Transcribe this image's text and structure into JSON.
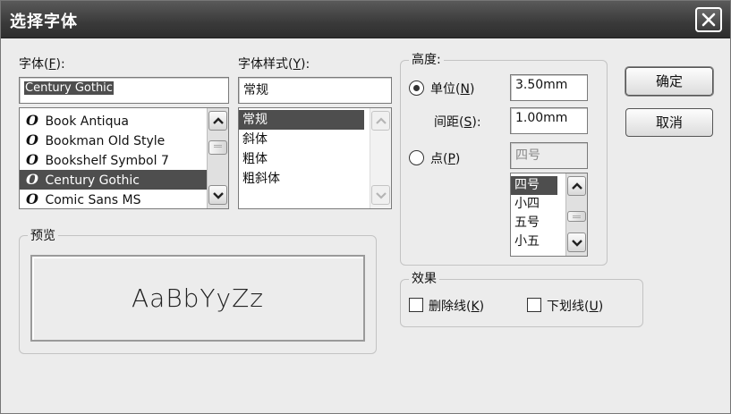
{
  "window": {
    "title": "选择字体",
    "close_symbol": "✕"
  },
  "font": {
    "label_prefix": "字体(",
    "label_key": "F",
    "label_suffix": "):",
    "value": "Century Gothic",
    "items": [
      {
        "glyph": "O",
        "label": "Book Antiqua"
      },
      {
        "glyph": "O",
        "label": "Bookman Old Style"
      },
      {
        "glyph": "O",
        "label": "Bookshelf Symbol 7"
      },
      {
        "glyph": "O",
        "label": "Century Gothic"
      },
      {
        "glyph": "O",
        "label": "Comic Sans MS"
      }
    ],
    "selected_index": 3
  },
  "style": {
    "label_prefix": "字体样式(",
    "label_key": "Y",
    "label_suffix": "):",
    "value": "常规",
    "items": [
      "常规",
      "斜体",
      "粗体",
      "粗斜体"
    ],
    "selected_index": 0
  },
  "height": {
    "group_title": "高度:",
    "unit_label": "单位(",
    "unit_key": "N",
    "unit_suffix": ")",
    "unit_value": "3.50mm",
    "spacing_label": "间距(",
    "spacing_key": "S",
    "spacing_suffix": "):",
    "spacing_value": "1.00mm",
    "point_label": "点(",
    "point_key": "P",
    "point_suffix": ")",
    "point_value": "四号",
    "point_items": [
      "四号",
      "小四",
      "五号",
      "小五"
    ],
    "selected_mode": "unit"
  },
  "preview": {
    "group_title": "预览",
    "sample": "AaBbYyZz"
  },
  "effects": {
    "group_title": "效果",
    "strike_label": "删除线(",
    "strike_key": "K",
    "strike_suffix": ")",
    "underline_label": "下划线(",
    "underline_key": "U",
    "underline_suffix": ")",
    "strike_checked": false,
    "underline_checked": false
  },
  "buttons": {
    "ok": "确定",
    "cancel": "取消"
  },
  "colors": {
    "titlebar": "#3a3a3a",
    "selection": "#4e4e4e",
    "dialog_bg": "#ececec"
  },
  "icons": {
    "close": "close-icon",
    "scroll_up": "chevron-up-icon",
    "scroll_down": "chevron-down-icon",
    "font_type": "opentype-font-icon"
  }
}
